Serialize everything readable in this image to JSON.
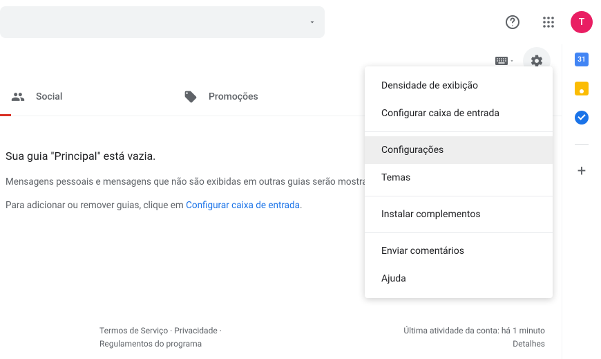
{
  "header": {
    "avatar_letter": "T"
  },
  "tabs": {
    "social": "Social",
    "promotions": "Promoções"
  },
  "empty": {
    "title": "Sua guia \"Principal\" está vazia.",
    "line1": "Mensagens pessoais e mensagens que não são exibidas em outras guias serão mostradas aqui.",
    "line2_prefix": "Para adicionar ou remover guias, clique em ",
    "line2_link": "Configurar caixa de entrada",
    "line2_suffix": "."
  },
  "menu": {
    "density": "Densidade de exibição",
    "inbox": "Configurar caixa de entrada",
    "settings": "Configurações",
    "themes": "Temas",
    "addons": "Instalar complementos",
    "feedback": "Enviar comentários",
    "help": "Ajuda"
  },
  "footer": {
    "terms": "Termos de Serviço",
    "privacy": "Privacidade",
    "program": "Regulamentos do programa",
    "activity": "Última atividade da conta: há 1 minuto",
    "details": "Detalhes"
  }
}
